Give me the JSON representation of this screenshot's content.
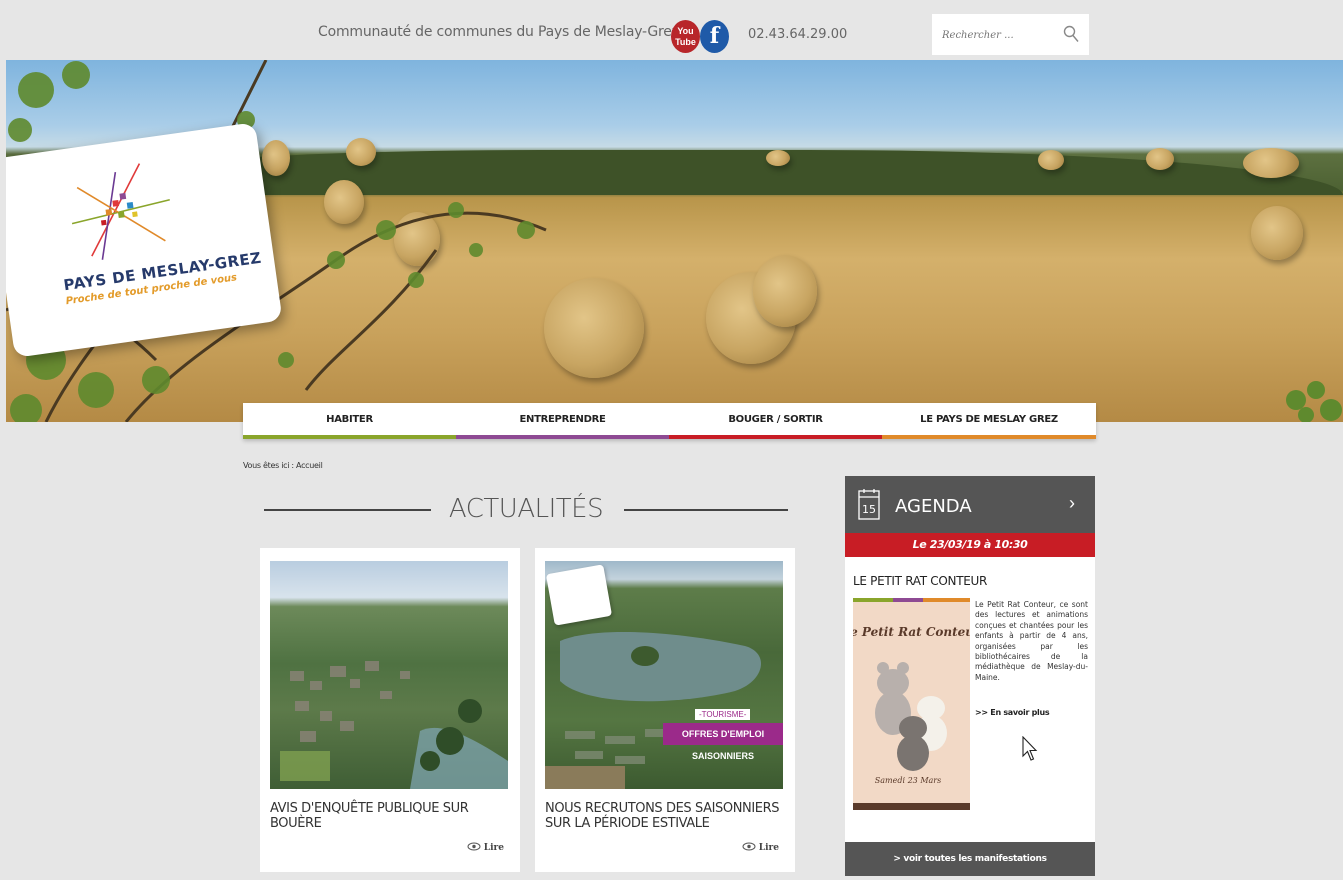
{
  "header": {
    "site_name": "Communauté de communes du Pays de Meslay-Grez",
    "youtube_label": "You Tube",
    "facebook_label": "f",
    "phone": "02.43.64.29.00",
    "search_placeholder": "Rechercher ..."
  },
  "logo": {
    "title": "PAYS DE MESLAY-GREZ",
    "tagline": "Proche de tout proche de vous"
  },
  "nav": {
    "items": [
      {
        "label": "HABITER",
        "color": "#8aa52b"
      },
      {
        "label": "ENTREPRENDRE",
        "color": "#8e4a93"
      },
      {
        "label": "BOUGER / SORTIR",
        "color": "#c81d25"
      },
      {
        "label": "LE PAYS DE MESLAY GREZ",
        "color": "#e08a2a"
      }
    ]
  },
  "breadcrumb": "Vous êtes ici : Accueil",
  "news": {
    "title": "ACTUALITÉS",
    "read_label": "Lire",
    "cards": [
      {
        "title": "AVIS D'ENQUÊTE PUBLIQUE SUR BOUÈRE"
      },
      {
        "title": "NOUS RECRUTONS DES SAISONNIERS SUR LA PÉRIODE ESTIVALE",
        "tag_category": "-TOURISME-",
        "tag_label": "OFFRES D'EMPLOI SAISONNIERS"
      }
    ]
  },
  "agenda": {
    "calendar_day": "15",
    "title": "AGENDA",
    "arrow": "›",
    "date": "Le 23/03/19 à 10:30",
    "event_title": "LE PETIT RAT CONTEUR",
    "poster_title": "Le Petit Rat Conteur",
    "poster_date": "Samedi 23 Mars",
    "description": "Le Petit Rat Conteur, ce sont des lectures et animations conçues et chantées pour les enfants à partir de 4 ans, organisées par les bibliothécaires de la médiathèque de Meslay-du-Maine.",
    "more_label": ">> En savoir plus",
    "footer_label": "> voir toutes les manifestations"
  },
  "colors": {
    "accent_red": "#c81d25",
    "dark_panel": "#555555",
    "promo_purple": "#9b2a8a"
  }
}
